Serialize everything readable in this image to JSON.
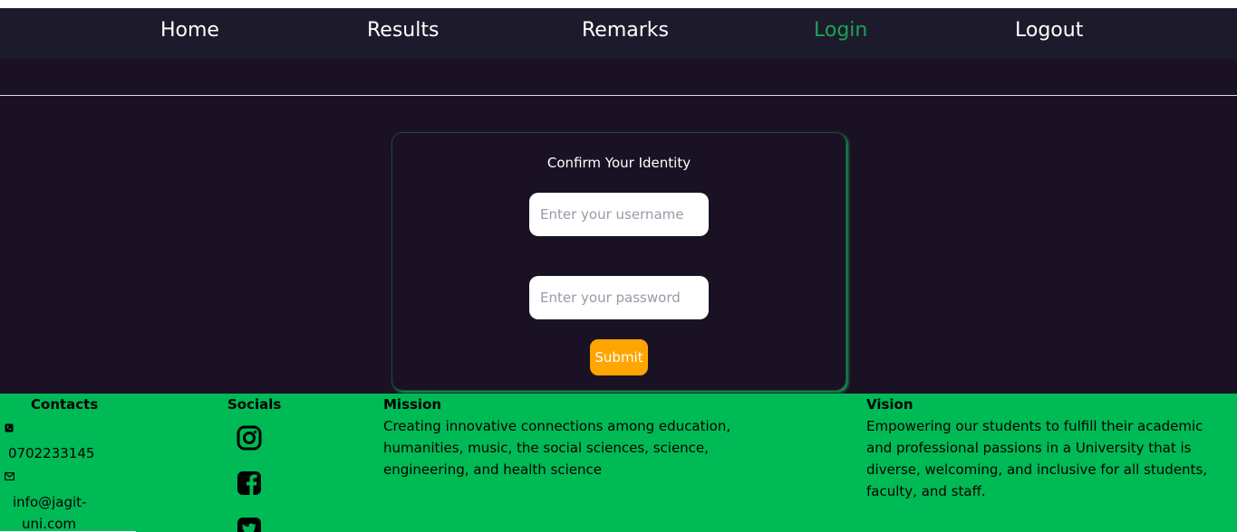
{
  "nav": {
    "items": [
      {
        "label": "Home"
      },
      {
        "label": "Results"
      },
      {
        "label": "Remarks"
      },
      {
        "label": "Login"
      },
      {
        "label": "Logout"
      }
    ],
    "active": "Login"
  },
  "login": {
    "title": "Confirm Your Identity",
    "username_placeholder": "Enter your username",
    "password_placeholder": "Enter your password",
    "submit_label": "Submit"
  },
  "footer": {
    "contacts": {
      "heading": "Contacts",
      "phone": "0702233145",
      "email": "info@jagit-uni.com"
    },
    "socials": {
      "heading": "Socials",
      "icons": [
        "instagram-icon",
        "facebook-icon",
        "twitter-icon"
      ]
    },
    "mission": {
      "heading": "Mission",
      "text": "Creating innovative connections among education, humanities, music, the social sciences, science, engineering, and health science"
    },
    "vision": {
      "heading": "Vision",
      "text": "Empowering our students to fulfill their academic and professional passions in a University that is diverse, welcoming, and inclusive for all students, faculty, and staff."
    }
  },
  "colors": {
    "background": "#1a1224",
    "navbar": "#1d1b2b",
    "active_link": "#1aa35a",
    "submit": "#ffa500",
    "footer": "#00ba55"
  }
}
